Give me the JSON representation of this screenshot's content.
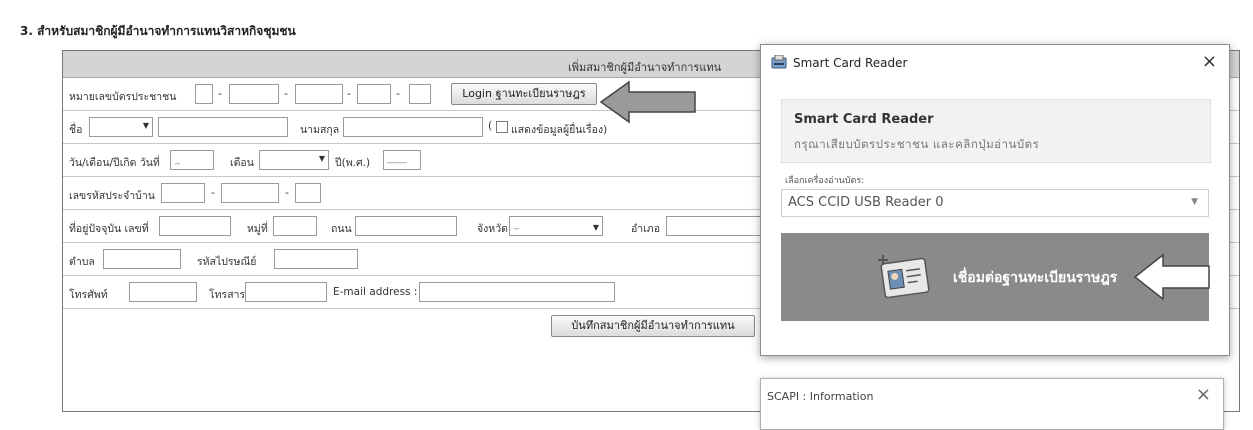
{
  "section_title": "3. สำหรับสมาชิกผู้มีอำนาจทำการแทนวิสาหกิจชุมชน",
  "form": {
    "header": "เพิ่มสมาชิกผู้มีอำนาจทำการแทน",
    "id_label": "หมายเลขบัตรประชาชน",
    "login_button": "Login ฐานทะเบียนราษฎร",
    "name_label": "ชื่อ",
    "surname_label": "นามสกุล",
    "show_applicant_prefix": "(",
    "show_applicant_label": "แสดงข้อมูลผู้ยื่นเรื่อง)",
    "dob_label": "วัน/เดือน/ปีเกิด วันที่",
    "dob_day_value": "_",
    "month_label": "เดือน",
    "year_label": "ปี(พ.ศ.)",
    "year_value": "____",
    "house_code_label": "เลขรหัสประจำบ้าน",
    "address_label": "ที่อยู่ปัจจุบัน เลขที่",
    "moo_label": "หมู่ที่",
    "road_label": "ถนน",
    "province_label": "จังหวัด",
    "province_value": "_",
    "district_label": "อำเภอ",
    "subdistrict_label": "ตำบล",
    "postal_label": "รหัสไปรษณีย์",
    "phone_label": "โทรศัพท์",
    "fax_label": "โทรสาร",
    "email_label": "E-mail address :",
    "save_button": "บันทึกสมาชิกผู้มีอำนาจทำการแทน"
  },
  "smart_card_dialog": {
    "title": "Smart Card Reader",
    "close": "×",
    "heading": "Smart Card Reader",
    "instruction": "กรุณาเสียบบัตรประชาชน และคลิกปุ่มอ่านบัตร",
    "reader_label": "เลือกเครื่องอ่านบัตร:",
    "reader_value": "ACS CCID USB Reader 0",
    "connect_button": "เชื่อมต่อฐานทะเบียนราษฎร"
  },
  "info_dialog": {
    "title": "SCAPI : Information",
    "close": "×"
  },
  "icons": {
    "card_reader_title_icon": "card-reader-icon",
    "id_card_icon": "id-card-icon",
    "pointer_arrow": "arrow-left-icon"
  },
  "colors": {
    "header_bg": "#d4d4d4",
    "connect_bg": "#8a8a8a",
    "arrow_fill": "#9a9a9a"
  }
}
